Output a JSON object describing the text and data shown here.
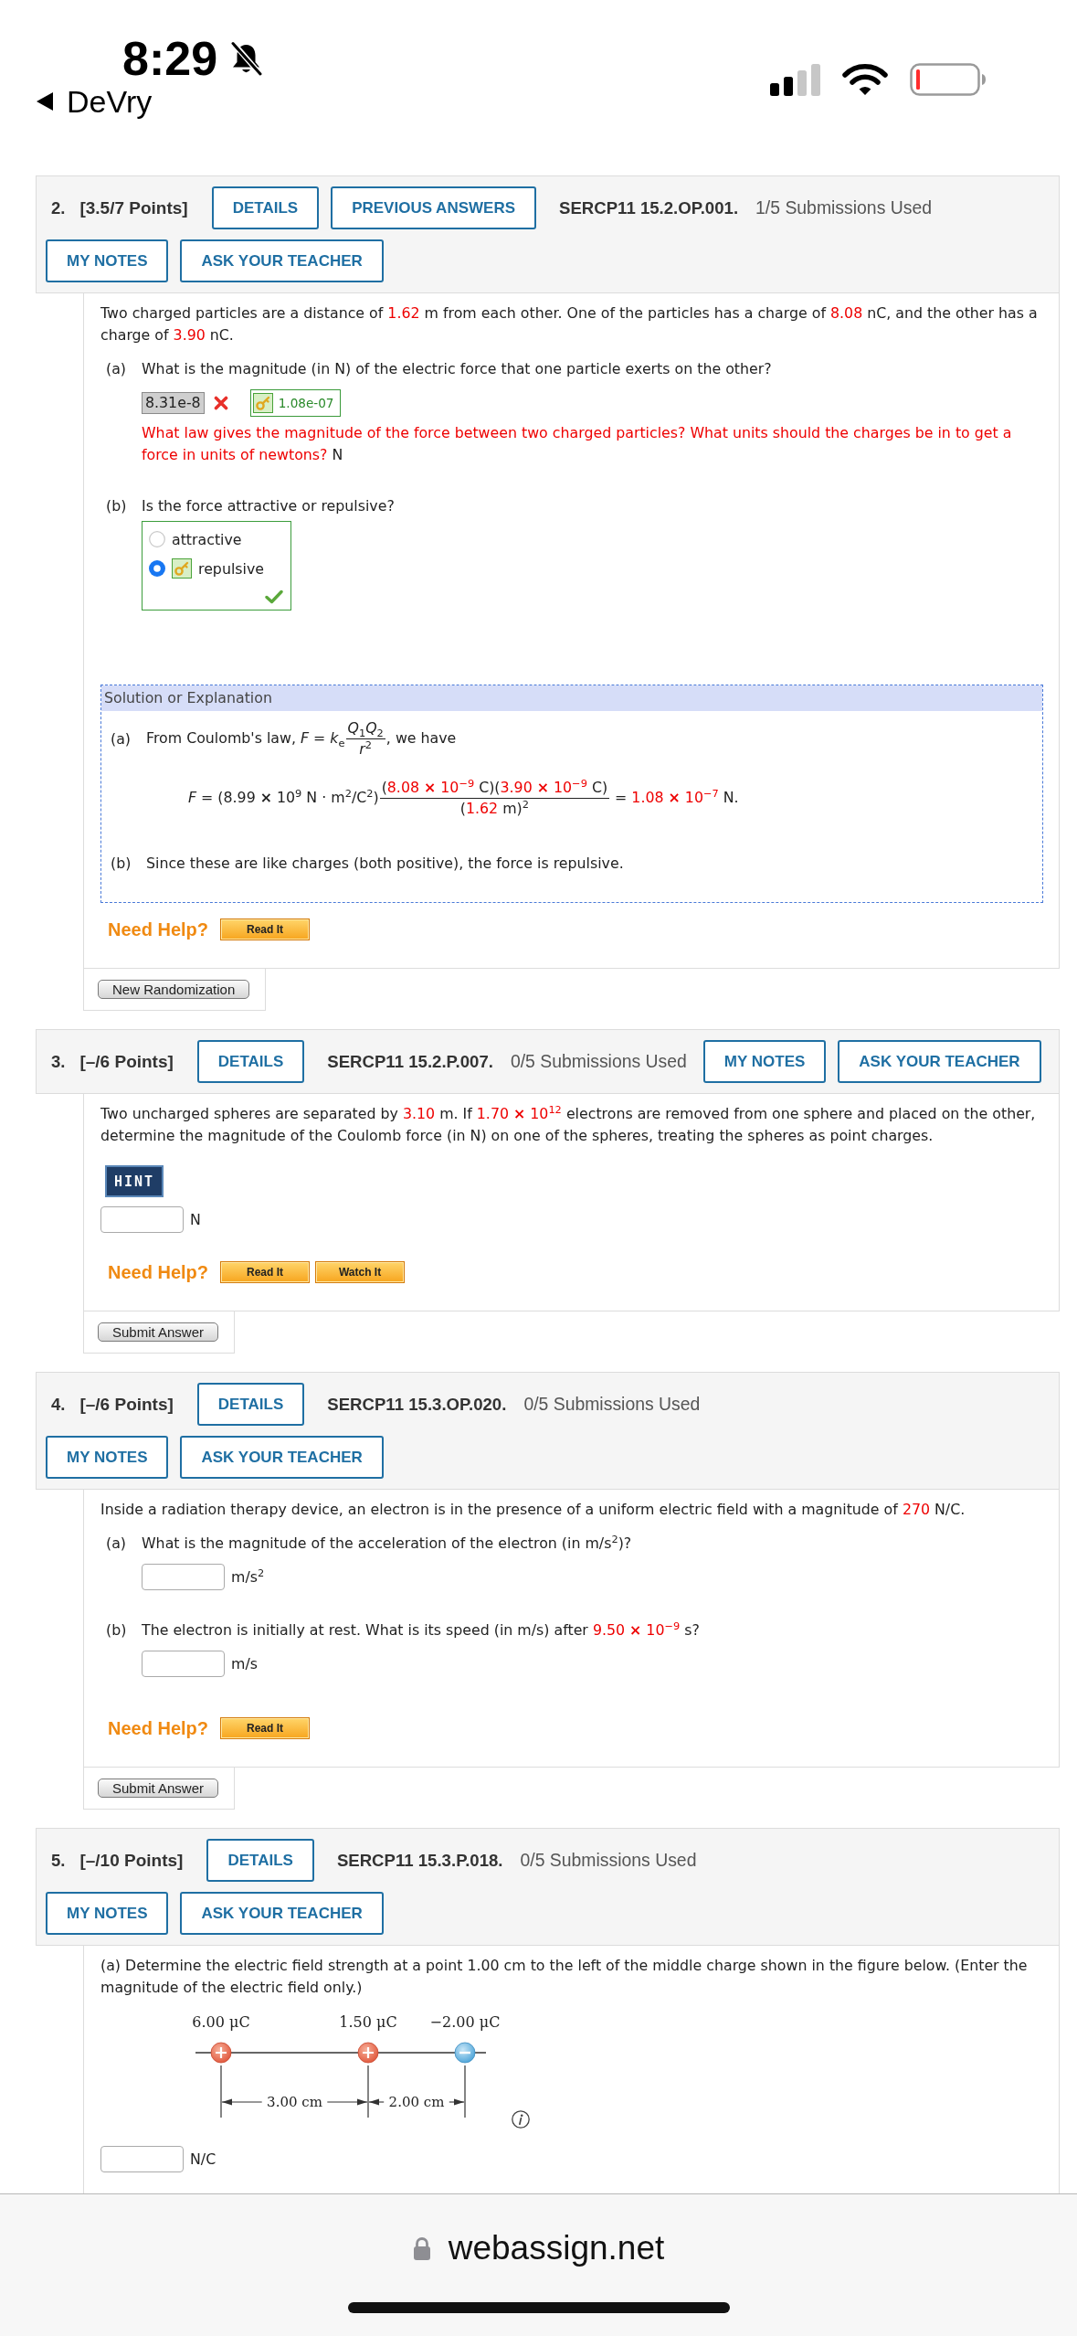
{
  "status_bar": {
    "time": "8:29",
    "back_label": "DeVry"
  },
  "problems": [
    {
      "header": {
        "number": "2.",
        "points": "[3.5/7 Points]",
        "buttons_before": [
          "DETAILS",
          "PREVIOUS ANSWERS"
        ],
        "code": "SERCP11 15.2.OP.001.",
        "submissions": "1/5 Submissions Used",
        "buttons_after": [
          "MY NOTES",
          "ASK YOUR TEACHER"
        ]
      },
      "blocks": [
        {
          "kind": "paragraph",
          "segments": [
            {
              "kind": "text",
              "text": "Two charged particles are a distance of "
            },
            {
              "kind": "value",
              "text": "1.62"
            },
            {
              "kind": "text",
              "text": " m from each other. One of the particles has a charge of "
            },
            {
              "kind": "value",
              "text": "8.08"
            },
            {
              "kind": "text",
              "text": " nC, and the other has a charge of "
            },
            {
              "kind": "value",
              "text": "3.90"
            },
            {
              "kind": "text",
              "text": " nC."
            }
          ]
        },
        {
          "kind": "part",
          "label": "(a)",
          "segments": [
            {
              "kind": "text",
              "text": "What is the magnitude (in N) of the electric force that one particle exerts on the other?"
            }
          ],
          "response": {
            "kind": "graded",
            "value": "8.31e-8",
            "correct": false,
            "key": "1.08e-07"
          },
          "feedback": [
            {
              "kind": "message",
              "text": "What law gives the magnitude of the force between two charged particles? What units should the charges be in to get a force in units of newtons?"
            },
            {
              "kind": "text",
              "text": " N"
            }
          ]
        },
        {
          "kind": "part",
          "label": "(b)",
          "segments": [
            {
              "kind": "text",
              "text": "Is the force attractive or repulsive?"
            }
          ],
          "response": {
            "kind": "choice",
            "correct": true,
            "options": [
              {
                "label": "attractive",
                "selected": false,
                "key": false
              },
              {
                "label": "repulsive",
                "selected": true,
                "key": true
              }
            ]
          }
        },
        {
          "kind": "solution",
          "title": "Solution or Explanation",
          "lines": [
            {
              "kind": "step",
              "label": "(a)",
              "segments": [
                {
                  "kind": "text",
                  "text": "From Coulomb's law, *F* = *k*$_{e}$"
                },
                {
                  "kind": "fraction",
                  "numerator": [
                    {
                      "kind": "text",
                      "text": "*Q*$_{1}$*Q*$_{2}$"
                    }
                  ],
                  "denominator": [
                    {
                      "kind": "text",
                      "text": "*r*$^{2}$"
                    }
                  ]
                },
                {
                  "kind": "text",
                  "text": ", we have"
                }
              ]
            },
            {
              "kind": "equation",
              "segments": [
                {
                  "kind": "text",
                  "text": "*F* = (8.99 **×** 10$^{9}$ N · m$^{2}$/C$^{2}$)"
                },
                {
                  "kind": "fraction",
                  "numerator": [
                    {
                      "kind": "text",
                      "text": "("
                    },
                    {
                      "kind": "value",
                      "text": "8.08 **×** 10$^{−9}$"
                    },
                    {
                      "kind": "text",
                      "text": " C)("
                    },
                    {
                      "kind": "value",
                      "text": "3.90 **×** 10$^{−9}$"
                    },
                    {
                      "kind": "text",
                      "text": " C)"
                    }
                  ],
                  "denominator": [
                    {
                      "kind": "text",
                      "text": "("
                    },
                    {
                      "kind": "value",
                      "text": "1.62"
                    },
                    {
                      "kind": "text",
                      "text": " m)$^{2}$"
                    }
                  ]
                },
                {
                  "kind": "text",
                  "text": " = "
                },
                {
                  "kind": "value",
                  "text": "1.08 **×** 10$^{−7}$"
                },
                {
                  "kind": "text",
                  "text": " N."
                }
              ]
            },
            {
              "kind": "step",
              "label": "(b)",
              "segments": [
                {
                  "kind": "text",
                  "text": "Since these are like charges (both positive), the force is repulsive."
                }
              ]
            }
          ]
        },
        {
          "kind": "help",
          "title": "Need Help?",
          "buttons": [
            "Read It"
          ]
        }
      ],
      "footer_button": "New Randomization"
    },
    {
      "header": {
        "number": "3.",
        "points": "[–/6 Points]",
        "buttons_before": [
          "DETAILS"
        ],
        "code": "SERCP11 15.2.P.007.",
        "submissions": "0/5 Submissions Used",
        "buttons_after": [
          "MY NOTES",
          "ASK YOUR TEACHER"
        ]
      },
      "blocks": [
        {
          "kind": "paragraph",
          "segments": [
            {
              "kind": "text",
              "text": "Two uncharged spheres are separated by "
            },
            {
              "kind": "value",
              "text": "3.10"
            },
            {
              "kind": "text",
              "text": " m. If "
            },
            {
              "kind": "value",
              "text": "1.70 **×** 10$^{12}$"
            },
            {
              "kind": "text",
              "text": " electrons are removed from one sphere and placed on the other, determine the magnitude of the Coulomb force (in N) on one of the spheres, treating the spheres as point charges."
            }
          ]
        },
        {
          "kind": "hint",
          "label": "HINT"
        },
        {
          "kind": "blank",
          "unit": "N"
        },
        {
          "kind": "help",
          "title": "Need Help?",
          "buttons": [
            "Read It",
            "Watch It"
          ]
        }
      ],
      "footer_button": "Submit Answer"
    },
    {
      "header": {
        "number": "4.",
        "points": "[–/6 Points]",
        "buttons_before": [
          "DETAILS"
        ],
        "code": "SERCP11 15.3.OP.020.",
        "submissions": "0/5 Submissions Used",
        "buttons_after": [
          "MY NOTES",
          "ASK YOUR TEACHER"
        ]
      },
      "blocks": [
        {
          "kind": "paragraph",
          "segments": [
            {
              "kind": "text",
              "text": "Inside a radiation therapy device, an electron is in the presence of a uniform electric field with a magnitude of "
            },
            {
              "kind": "value",
              "text": "270"
            },
            {
              "kind": "text",
              "text": " N/C."
            }
          ]
        },
        {
          "kind": "part",
          "label": "(a)",
          "segments": [
            {
              "kind": "text",
              "text": "What is the magnitude of the acceleration of the electron (in m/s$^{2}$)?"
            }
          ],
          "response": {
            "kind": "blank",
            "unit": "m/s$^{2}$"
          }
        },
        {
          "kind": "part",
          "label": "(b)",
          "segments": [
            {
              "kind": "text",
              "text": "The electron is initially at rest. What is its speed (in m/s) after "
            },
            {
              "kind": "value",
              "text": "9.50 **×** 10$^{−9}$"
            },
            {
              "kind": "text",
              "text": " s?"
            }
          ],
          "response": {
            "kind": "blank",
            "unit": "m/s"
          }
        },
        {
          "kind": "help",
          "title": "Need Help?",
          "buttons": [
            "Read It"
          ]
        }
      ],
      "footer_button": "Submit Answer"
    },
    {
      "header": {
        "number": "5.",
        "points": "[–/10 Points]",
        "buttons_before": [
          "DETAILS"
        ],
        "code": "SERCP11 15.3.P.018.",
        "submissions": "0/5 Submissions Used",
        "buttons_after": [
          "MY NOTES",
          "ASK YOUR TEACHER"
        ]
      },
      "blocks": [
        {
          "kind": "paragraph",
          "segments": [
            {
              "kind": "text",
              "text": "(a) Determine the electric field strength at a point 1.00 cm to the left of the middle charge shown in the figure below. (Enter the magnitude of the electric field only.)"
            }
          ]
        },
        {
          "kind": "figure",
          "charges": [
            {
              "kind": "positive",
              "label": "6.00 μC"
            },
            {
              "kind": "positive",
              "label": "1.50 μC"
            },
            {
              "kind": "negative",
              "label": "−2.00 μC"
            }
          ],
          "distances": [
            "3.00 cm",
            "2.00 cm"
          ]
        },
        {
          "kind": "blank",
          "unit": "N/C"
        }
      ]
    }
  ],
  "browser_bar": {
    "url": "webassign.net"
  }
}
